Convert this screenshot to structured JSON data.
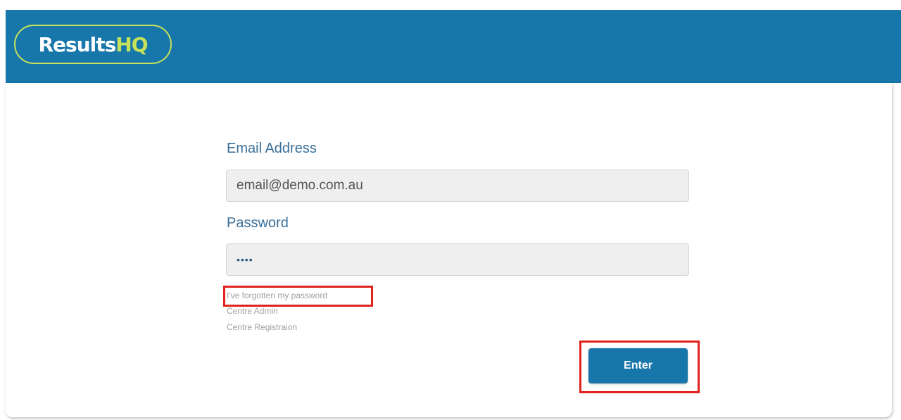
{
  "header": {
    "logo_main": "Results",
    "logo_accent": "HQ"
  },
  "form": {
    "email_label": "Email Address",
    "email_value": "email@demo.com.au",
    "password_label": "Password",
    "password_value": "••••",
    "enter_label": "Enter"
  },
  "links": {
    "forgot_password": "I've forgotten my password",
    "centre_admin": "Centre Admin",
    "centre_registration": "Centre Registraion"
  },
  "colors": {
    "brand_blue": "#1776aa",
    "logo_accent": "#c6e15a",
    "highlight_red": "#e0231c"
  }
}
